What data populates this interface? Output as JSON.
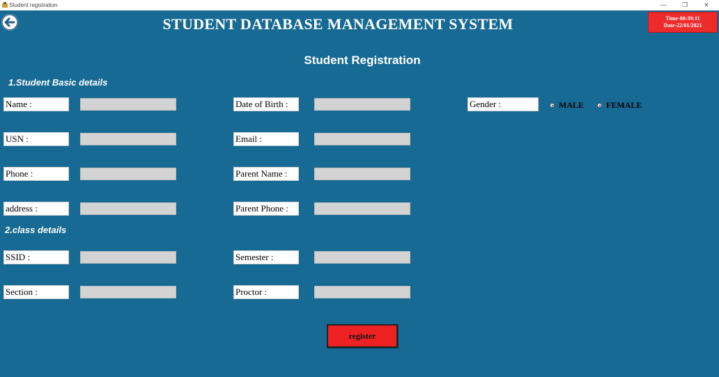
{
  "window": {
    "title": "Student registration",
    "controls": {
      "minimize": "—",
      "restore": "❐",
      "close": "✕"
    }
  },
  "header": {
    "title": "STUDENT DATABASE MANAGEMENT SYSTEM",
    "time": "Time-00:39:11",
    "date": "Date-22/01/2021"
  },
  "form": {
    "title": "Student Registration",
    "section1": "1.Student Basic details",
    "section2": "2.class details",
    "labels": {
      "name": "Name :",
      "dob": "Date of Birth :",
      "gender": "Gender :",
      "usn": "USN :",
      "email": "Email :",
      "phone": "Phone :",
      "parent_name": "Parent Name :",
      "address": "address :",
      "parent_phone": "Parent Phone :",
      "ssid": "SSID :",
      "semester": "Semester :",
      "section": "Section :",
      "proctor": "Proctor :"
    },
    "values": {
      "name": "",
      "dob": "",
      "usn": "",
      "email": "",
      "phone": "",
      "parent_name": "",
      "address": "",
      "parent_phone": "",
      "ssid": "",
      "semester": "",
      "section": "",
      "proctor": ""
    },
    "gender_options": {
      "male": "MALE",
      "female": "FEMALE"
    },
    "register_label": "register"
  },
  "colors": {
    "background": "#176a94",
    "accent_red": "#ee2222",
    "input_bg": "#d3d3d3"
  }
}
